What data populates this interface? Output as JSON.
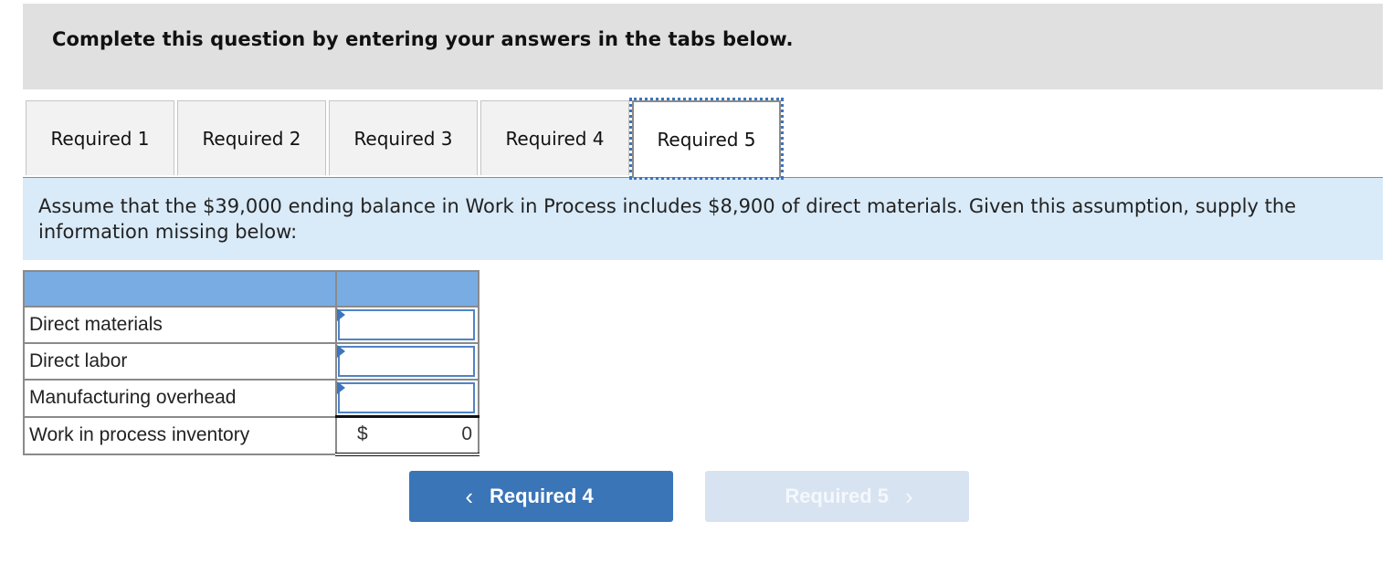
{
  "instruction": "Complete this question by entering your answers in the tabs below.",
  "tabs": [
    {
      "label": "Required 1",
      "active": false
    },
    {
      "label": "Required 2",
      "active": false
    },
    {
      "label": "Required 3",
      "active": false
    },
    {
      "label": "Required 4",
      "active": false
    },
    {
      "label": "Required 5",
      "active": true
    }
  ],
  "prompt": "Assume that the $39,000 ending balance in Work in Process includes $8,900 of direct materials. Given this assumption, supply the information missing below:",
  "table": {
    "header": [
      "",
      ""
    ],
    "rows": [
      {
        "label": "Direct materials",
        "value": ""
      },
      {
        "label": "Direct labor",
        "value": ""
      },
      {
        "label": "Manufacturing overhead",
        "value": ""
      }
    ],
    "total": {
      "label": "Work in process inventory",
      "currency": "$",
      "value": "0"
    }
  },
  "nav": {
    "prev_label": "Required 4",
    "prev_icon": "chevron-left-icon",
    "next_label": "Required 5",
    "next_icon": "chevron-right-icon",
    "next_disabled": true
  },
  "colors": {
    "accent": "#3a75b8",
    "table_header": "#79ace3",
    "prompt_bg": "#d9eaf8",
    "disabled_btn": "#d7e3f1"
  }
}
